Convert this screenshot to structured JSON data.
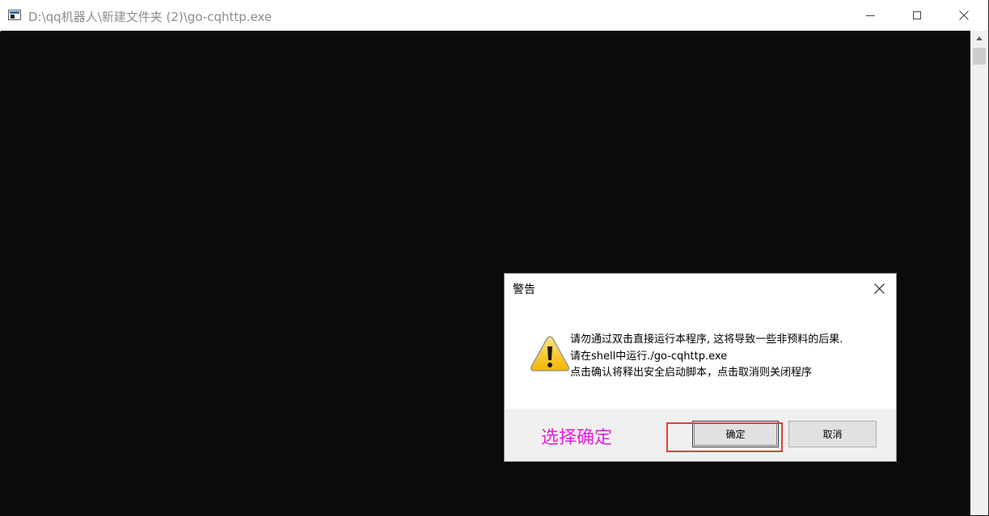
{
  "window": {
    "title": "D:\\qq机器人\\新建文件夹 (2)\\go-cqhttp.exe",
    "icon": "console-app-icon",
    "controls": [
      "minimize-icon",
      "maximize-icon",
      "close-icon"
    ]
  },
  "dialog": {
    "title": "警告",
    "icon": "warning-icon",
    "message_lines": [
      "请勿通过双击直接运行本程序, 这将导致一些非预料的后果.",
      "请在shell中运行./go-cqhttp.exe",
      "点击确认将释出安全启动脚本，点击取消则关闭程序"
    ],
    "ok_label": "确定",
    "cancel_label": "取消"
  },
  "annotation": {
    "text": "选择确定",
    "text_color": "#e020e0",
    "box_color": "#e83a3a"
  },
  "colors": {
    "console_bg": "#0c0c0c",
    "dialog_footer_bg": "#f0f0f0"
  }
}
